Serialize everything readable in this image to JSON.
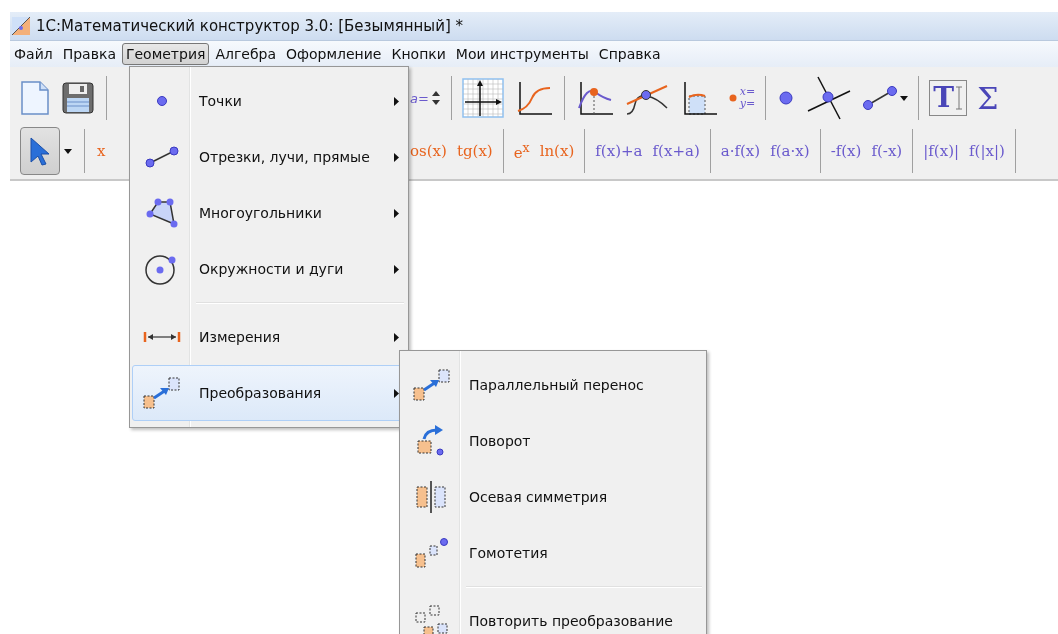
{
  "window": {
    "title": "1С:Математический конструктор 3.0: [Безымянный] *"
  },
  "menu_bar": [
    {
      "label": "Файл",
      "selected": false
    },
    {
      "label": "Правка",
      "selected": false
    },
    {
      "label": "Геометрия",
      "selected": true
    },
    {
      "label": "Алгебра",
      "selected": false
    },
    {
      "label": "Оформление",
      "selected": false
    },
    {
      "label": "Кнопки",
      "selected": false
    },
    {
      "label": "Мои инструменты",
      "selected": false
    },
    {
      "label": "Справка",
      "selected": false
    }
  ],
  "toolbar_row_1": {
    "left": [
      {
        "kind": "new"
      },
      {
        "kind": "save"
      },
      {
        "kind": "separator"
      }
    ],
    "right": [
      {
        "kind": "spinner",
        "label": "a="
      },
      {
        "kind": "separator"
      },
      {
        "kind": "grid"
      },
      {
        "kind": "graph"
      },
      {
        "kind": "separator"
      },
      {
        "kind": "extremum"
      },
      {
        "kind": "curve_intersection"
      },
      {
        "kind": "area"
      },
      {
        "kind": "equation",
        "lines": [
          "x=",
          "y="
        ]
      },
      {
        "kind": "separator"
      },
      {
        "kind": "point"
      },
      {
        "kind": "lines_intersection"
      },
      {
        "kind": "segment",
        "dropdown": true
      },
      {
        "kind": "separator"
      },
      {
        "kind": "text_tool",
        "label": "T"
      },
      {
        "kind": "sum",
        "label": "Σ"
      }
    ]
  },
  "toolbar_row_2": {
    "left": [
      {
        "kind": "pointer",
        "selected": true,
        "dropdown": true
      },
      {
        "kind": "separator"
      },
      {
        "kind": "function",
        "label": "x",
        "color": "#e8641e"
      }
    ],
    "right": [
      {
        "kind": "function",
        "label": "os(x)",
        "color": "#e8641e"
      },
      {
        "kind": "function",
        "label": "tg(x)",
        "color": "#e8641e"
      },
      {
        "kind": "separator"
      },
      {
        "kind": "function",
        "label": "e$^{x}$",
        "color": "#e8641e"
      },
      {
        "kind": "function",
        "label": "ln(x)",
        "color": "#e8641e"
      },
      {
        "kind": "separator"
      },
      {
        "kind": "function",
        "label": "f(x)+a",
        "color": "#6a5acd"
      },
      {
        "kind": "function",
        "label": "f(x+a)",
        "color": "#6a5acd"
      },
      {
        "kind": "separator"
      },
      {
        "kind": "function",
        "label": "a·f(x)",
        "color": "#6a5acd"
      },
      {
        "kind": "function",
        "label": "f(a·x)",
        "color": "#6a5acd"
      },
      {
        "kind": "separator"
      },
      {
        "kind": "function",
        "label": "-f(x)",
        "color": "#6a5acd"
      },
      {
        "kind": "function",
        "label": "f(-x)",
        "color": "#6a5acd"
      },
      {
        "kind": "separator"
      },
      {
        "kind": "function",
        "label": "|f(x)|",
        "color": "#6a5acd"
      },
      {
        "kind": "function",
        "label": "f(|x|)",
        "color": "#6a5acd"
      },
      {
        "kind": "separator"
      }
    ]
  },
  "geometry_menu": [
    {
      "label": "Точки",
      "kind": "point",
      "selected": false,
      "separator_before": false
    },
    {
      "label": "Отрезки, лучи, прямые",
      "kind": "segment",
      "selected": false,
      "separator_before": false
    },
    {
      "label": "Многоугольники",
      "kind": "polygon",
      "selected": false,
      "separator_before": false
    },
    {
      "label": "Окружности и дуги",
      "kind": "circle",
      "selected": false,
      "separator_before": false
    },
    {
      "label": "Измерения",
      "kind": "measure",
      "selected": false,
      "separator_before": true
    },
    {
      "label": "Преобразования",
      "kind": "translation",
      "selected": true,
      "separator_before": false
    }
  ],
  "transformations_submenu": [
    {
      "label": "Параллельный перенос",
      "kind": "translation",
      "separator_before": false
    },
    {
      "label": "Поворот",
      "kind": "rotation",
      "separator_before": false
    },
    {
      "label": "Осевая симметрия",
      "kind": "reflection",
      "separator_before": false
    },
    {
      "label": "Гомотетия",
      "kind": "homothety",
      "separator_before": false
    },
    {
      "label": "Повторить преобразование",
      "kind": "repeat",
      "separator_before": true
    }
  ]
}
